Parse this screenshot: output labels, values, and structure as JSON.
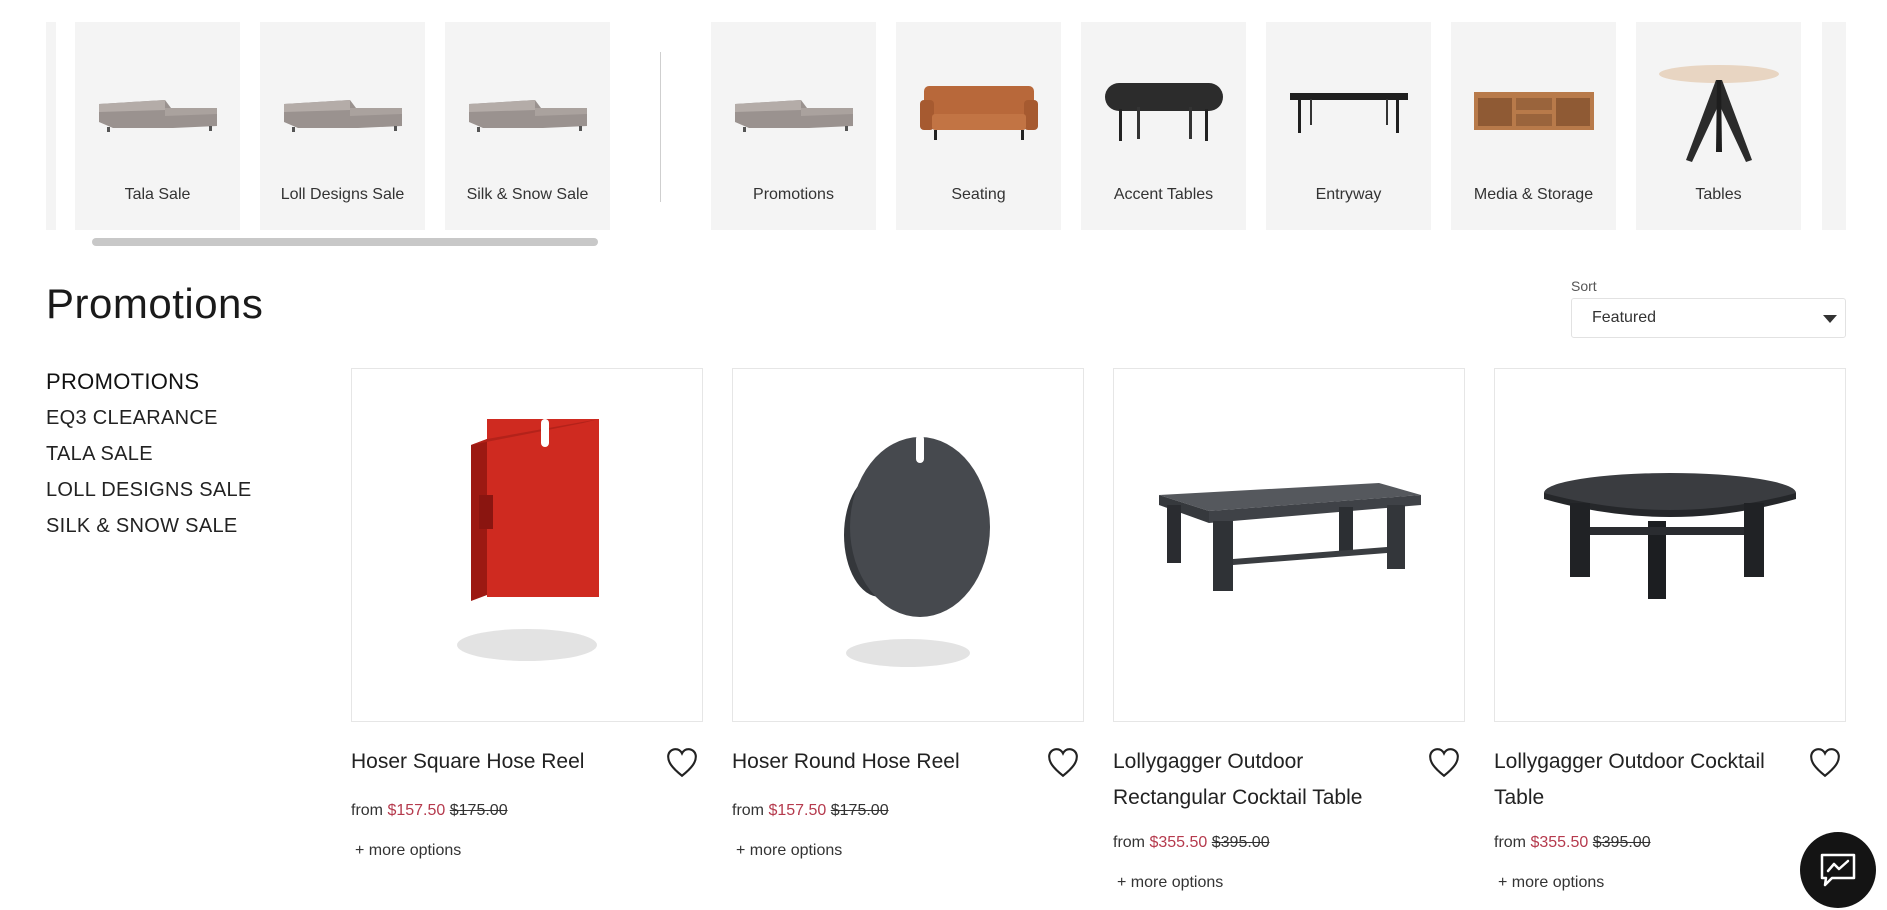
{
  "category_strip": {
    "left_tiles": [
      {
        "label": "Tala Sale",
        "icon": "sectional-sofa-icon"
      },
      {
        "label": "Loll Designs Sale",
        "icon": "sectional-sofa-icon"
      },
      {
        "label": "Silk & Snow Sale",
        "icon": "sectional-sofa-icon"
      }
    ],
    "right_tiles": [
      {
        "label": "Promotions",
        "icon": "sectional-sofa-icon"
      },
      {
        "label": "Seating",
        "icon": "leather-sofa-icon"
      },
      {
        "label": "Accent Tables",
        "icon": "oval-table-icon"
      },
      {
        "label": "Entryway",
        "icon": "bench-icon"
      },
      {
        "label": "Media & Storage",
        "icon": "media-console-icon"
      },
      {
        "label": "Tables",
        "icon": "round-table-icon"
      }
    ]
  },
  "page": {
    "title": "Promotions"
  },
  "sort": {
    "label": "Sort",
    "value": "Featured"
  },
  "sidebar": {
    "items": [
      "PROMOTIONS",
      "EQ3 CLEARANCE",
      "TALA SALE",
      "LOLL DESIGNS SALE",
      "SILK & SNOW SALE"
    ]
  },
  "products": [
    {
      "name": "Hoser Square Hose Reel",
      "from": "from",
      "sale_price": "$157.50",
      "original_price": "$175.00",
      "more": "+ more options",
      "image": "square-hose-reel-image",
      "color": "#c9241d"
    },
    {
      "name": "Hoser Round Hose Reel",
      "from": "from",
      "sale_price": "$157.50",
      "original_price": "$175.00",
      "more": "+ more options",
      "image": "round-hose-reel-image",
      "color": "#45484d"
    },
    {
      "name": "Lollygagger Outdoor Rectangular Cocktail Table",
      "from": "from",
      "sale_price": "$355.50",
      "original_price": "$395.00",
      "more": "+ more options",
      "image": "rectangular-table-image",
      "color": "#3f4247"
    },
    {
      "name": "Lollygagger Outdoor Cocktail Table",
      "from": "from",
      "sale_price": "$355.50",
      "original_price": "$395.00",
      "more": "+ more options",
      "image": "round-cocktail-table-image",
      "color": "#2f3135"
    }
  ],
  "colors": {
    "sale": "#b53a4d",
    "tile_bg": "#f4f4f4",
    "chat_bg": "#141414"
  }
}
